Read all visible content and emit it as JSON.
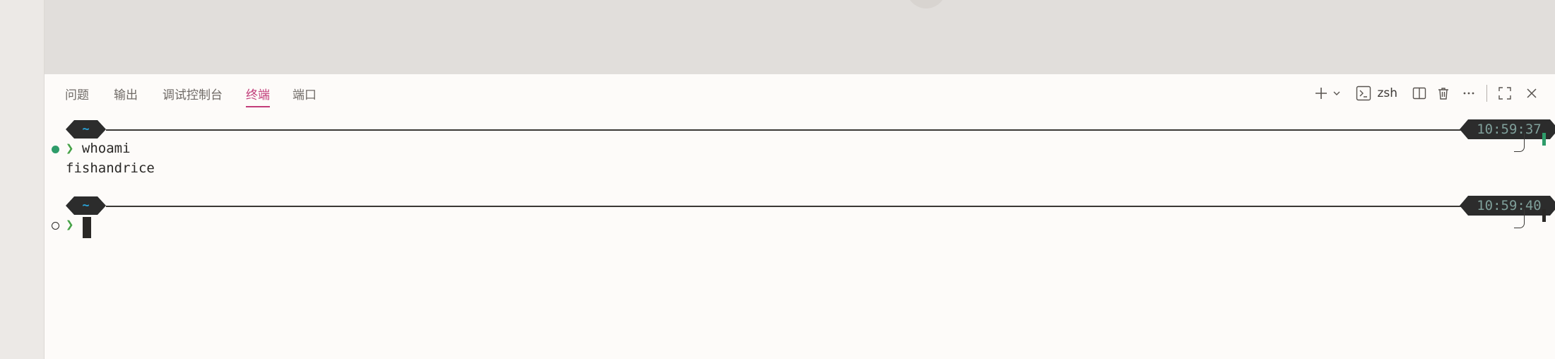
{
  "panel": {
    "tabs": [
      {
        "label": "问题",
        "active": false
      },
      {
        "label": "输出",
        "active": false
      },
      {
        "label": "调试控制台",
        "active": false
      },
      {
        "label": "终端",
        "active": true
      },
      {
        "label": "端口",
        "active": false
      }
    ],
    "toolbar": {
      "new_terminal_icon": "plus-icon",
      "dropdown_icon": "chevron-down-icon",
      "shell_icon": "terminal-icon",
      "shell_label": "zsh",
      "split_icon": "split-icon",
      "trash_icon": "trash-icon",
      "more_icon": "ellipsis-icon",
      "maximize_icon": "maximize-icon",
      "close_icon": "close-icon"
    }
  },
  "terminal": {
    "blocks": [
      {
        "dir": "~",
        "time": "10:59:37",
        "status": "success",
        "prompt_symbol": "❯",
        "command": "whoami",
        "output": "fishandrice"
      },
      {
        "dir": "~",
        "time": "10:59:40",
        "status": "pending",
        "prompt_symbol": "❯",
        "command": "",
        "output": ""
      }
    ]
  },
  "colors": {
    "accent": "#c23d7a",
    "prompt_chevron": "#46a247",
    "success_dot": "#2e9c6a",
    "dir_text": "#2aa3d8",
    "time_text": "#7f9f9a",
    "badge_bg": "#2c2c2c"
  }
}
